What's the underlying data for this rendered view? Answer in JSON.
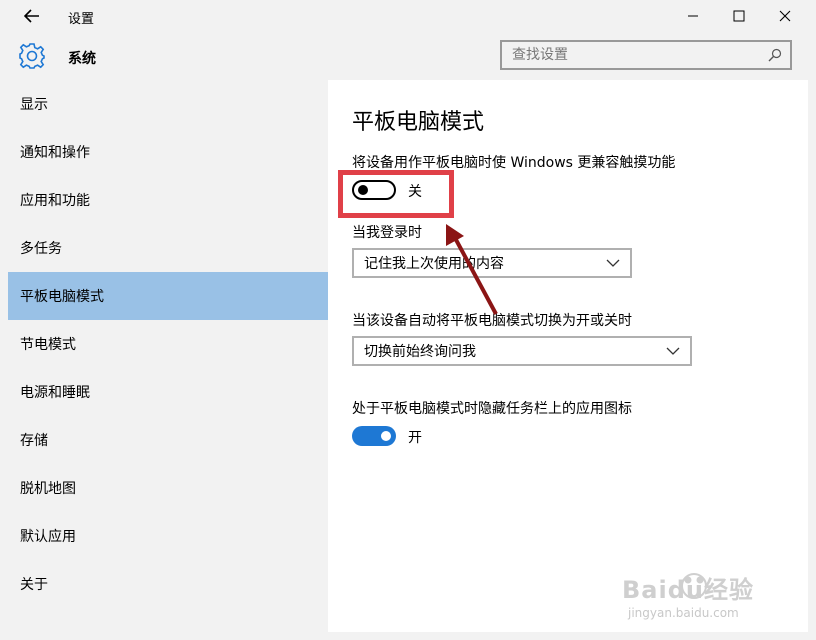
{
  "window": {
    "title": "设置"
  },
  "header": {
    "section_title": "系统",
    "search_placeholder": "查找设置"
  },
  "sidebar": {
    "items": [
      {
        "label": "显示",
        "selected": false
      },
      {
        "label": "通知和操作",
        "selected": false
      },
      {
        "label": "应用和功能",
        "selected": false
      },
      {
        "label": "多任务",
        "selected": false
      },
      {
        "label": "平板电脑模式",
        "selected": true
      },
      {
        "label": "节电模式",
        "selected": false
      },
      {
        "label": "电源和睡眠",
        "selected": false
      },
      {
        "label": "存储",
        "selected": false
      },
      {
        "label": "脱机地图",
        "selected": false
      },
      {
        "label": "默认应用",
        "selected": false
      },
      {
        "label": "关于",
        "selected": false
      }
    ]
  },
  "content": {
    "page_title": "平板电脑模式",
    "touch_label": "将设备用作平板电脑时使 Windows 更兼容触摸功能",
    "touch_toggle": {
      "state": "off",
      "text": "关"
    },
    "signin_label": "当我登录时",
    "signin_dropdown": {
      "value": "记住我上次使用的内容"
    },
    "auto_switch_label": "当该设备自动将平板电脑模式切换为开或关时",
    "auto_switch_dropdown": {
      "value": "切换前始终询问我"
    },
    "hide_icons_label": "处于平板电脑模式时隐藏任务栏上的应用图标",
    "hide_icons_toggle": {
      "state": "on",
      "text": "开"
    }
  },
  "annotation": {
    "highlight_color": "#e04048",
    "arrow_color": "#8b1515"
  },
  "watermark": {
    "brand": "Baidu经验",
    "url": "jingyan.baidu.com"
  },
  "colors": {
    "accent": "#1e78d4",
    "selected_nav": "#99c1e6"
  }
}
